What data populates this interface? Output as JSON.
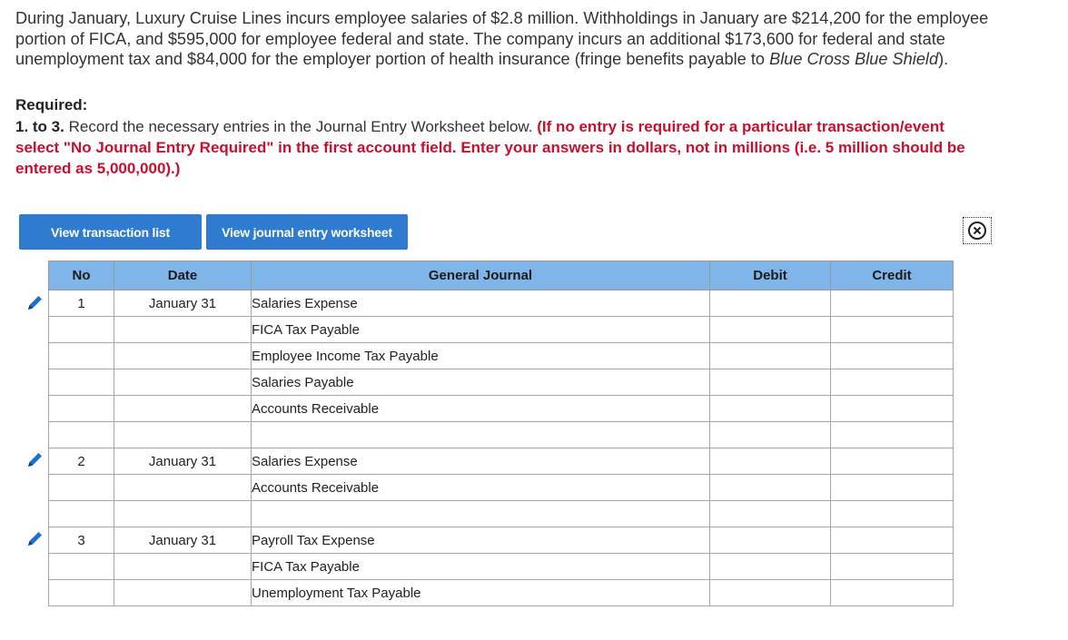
{
  "problem": {
    "line1": "During January, Luxury Cruise Lines incurs employee salaries of $2.8 million. Withholdings in January are $214,200 for the employee",
    "line2": "portion of FICA, and $595,000 for employee federal and state. The company incurs an additional $173,600 for federal and state",
    "line3_a": "unemployment tax and $84,000 for the employer portion of health insurance (fringe benefits payable to ",
    "line3_italic": "Blue Cross Blue Shield",
    "line3_b": ")."
  },
  "required": {
    "heading": "Required:",
    "number": "1. to 3.",
    "text": "Record the necessary entries in the Journal Entry Worksheet below.",
    "red1": "(If no entry is required for a particular transaction/event",
    "red2": "select \"No Journal Entry Required\" in the first account field. Enter your answers in dollars, not in millions (i.e. 5 million should be",
    "red3": "entered as 5,000,000).)"
  },
  "buttons": {
    "transaction_list": "View transaction list",
    "journal_worksheet": "View journal entry worksheet"
  },
  "icons": {
    "close": "close-circle-icon",
    "edit": "pencil-icon"
  },
  "table": {
    "headers": {
      "no": "No",
      "date": "Date",
      "journal": "General Journal",
      "debit": "Debit",
      "credit": "Credit"
    },
    "rows": [
      {
        "no": "1",
        "date": "January 31",
        "account": "Salaries Expense",
        "debit": "",
        "credit": ""
      },
      {
        "no": "",
        "date": "",
        "account": "FICA Tax Payable",
        "debit": "",
        "credit": ""
      },
      {
        "no": "",
        "date": "",
        "account": "Employee Income Tax Payable",
        "debit": "",
        "credit": ""
      },
      {
        "no": "",
        "date": "",
        "account": "Salaries Payable",
        "debit": "",
        "credit": ""
      },
      {
        "no": "",
        "date": "",
        "account": "Accounts Receivable",
        "debit": "",
        "credit": ""
      },
      {
        "no": "",
        "date": "",
        "account": "",
        "debit": "",
        "credit": ""
      },
      {
        "no": "2",
        "date": "January 31",
        "account": "Salaries Expense",
        "debit": "",
        "credit": ""
      },
      {
        "no": "",
        "date": "",
        "account": "Accounts Receivable",
        "debit": "",
        "credit": ""
      },
      {
        "no": "",
        "date": "",
        "account": "",
        "debit": "",
        "credit": ""
      },
      {
        "no": "3",
        "date": "January 31",
        "account": "Payroll Tax Expense",
        "debit": "",
        "credit": ""
      },
      {
        "no": "",
        "date": "",
        "account": "FICA Tax Payable",
        "debit": "",
        "credit": ""
      },
      {
        "no": "",
        "date": "",
        "account": "Unemployment Tax Payable",
        "debit": "",
        "credit": ""
      }
    ]
  },
  "colors": {
    "button_bg": "#2e7bcf",
    "header_bg": "#7fb5e8",
    "instruction_red": "#c8102e",
    "pencil": "#1e6fd0"
  }
}
